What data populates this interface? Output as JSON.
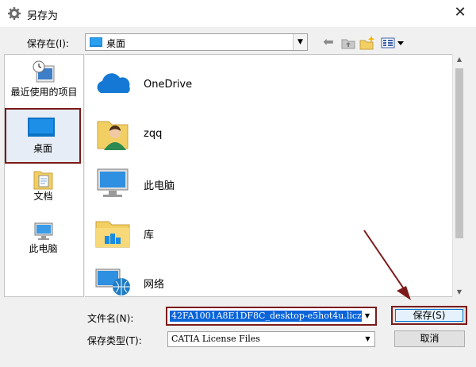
{
  "window": {
    "title": "另存为",
    "close_glyph": "✕"
  },
  "savein": {
    "label": "保存在(I):",
    "value": "桌面"
  },
  "places": [
    {
      "label": "最近使用的项目",
      "icon": "recent-icon"
    },
    {
      "label": "桌面",
      "icon": "desktop-icon"
    },
    {
      "label": "文档",
      "icon": "documents-icon"
    },
    {
      "label": "此电脑",
      "icon": "computer-icon"
    }
  ],
  "files": [
    {
      "name": "OneDrive",
      "icon": "onedrive-icon"
    },
    {
      "name": "zqq",
      "icon": "user-folder-icon"
    },
    {
      "name": "此电脑",
      "icon": "computer-icon"
    },
    {
      "name": "库",
      "icon": "library-icon"
    },
    {
      "name": "网络",
      "icon": "network-icon"
    }
  ],
  "filename": {
    "label": "文件名(N):",
    "value": "42FA1001A8E1DF8C_desktop-e5hot4u.licz"
  },
  "filetype": {
    "label": "保存类型(T):",
    "value": "CATIA License Files"
  },
  "buttons": {
    "save": "保存(S)",
    "cancel": "取消"
  },
  "colors": {
    "highlight": "#7b1a1a",
    "selection": "#0a64d8",
    "focus": "#0078d7"
  }
}
